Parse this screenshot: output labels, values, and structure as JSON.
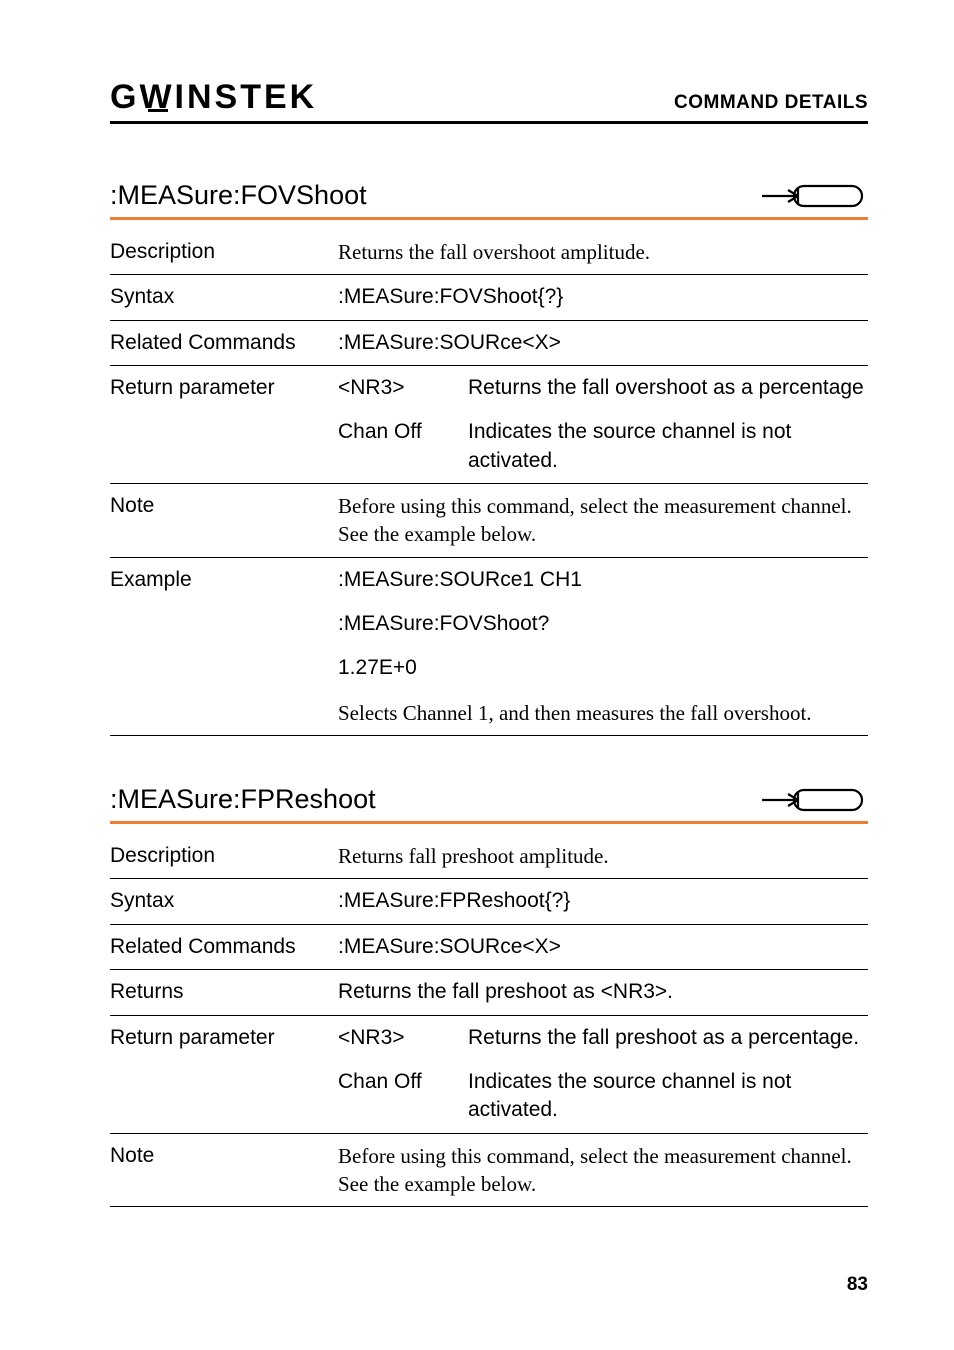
{
  "header": {
    "logo_text": "GWINSTEK",
    "section": "COMMAND DETAILS"
  },
  "page_number": "83",
  "icon": {
    "query": "query-icon"
  },
  "commands": [
    {
      "title": ":MEASure:FOVShoot",
      "rows": [
        {
          "label": "Description",
          "serif": true,
          "text": "Returns the fall overshoot amplitude."
        },
        {
          "label": "Syntax",
          "text": ":MEASure:FOVShoot{?}"
        },
        {
          "label": "Related Commands",
          "text": ":MEASure:SOURce<X>"
        },
        {
          "label": "Return parameter",
          "params": [
            {
              "key": "<NR3>",
              "desc": "Returns the fall overshoot as a percentage"
            },
            {
              "key": "Chan Off",
              "desc": "Indicates the source channel is not activated."
            }
          ]
        },
        {
          "label": "Note",
          "serif": true,
          "text": "Before using this command, select the measurement channel. See the example below."
        },
        {
          "label": "Example",
          "lines": [
            ":MEASure:SOURce1 CH1",
            ":MEASure:FOVShoot?",
            "1.27E+0"
          ],
          "serif_tail": "Selects Channel 1, and then measures the fall overshoot."
        }
      ]
    },
    {
      "title": ":MEASure:FPReshoot",
      "rows": [
        {
          "label": "Description",
          "serif": true,
          "text": "Returns fall preshoot amplitude."
        },
        {
          "label": "Syntax",
          "text": ":MEASure:FPReshoot{?}"
        },
        {
          "label": "Related Commands",
          "text": ":MEASure:SOURce<X>"
        },
        {
          "label": "Returns",
          "text": "Returns the fall preshoot as <NR3>."
        },
        {
          "label": "Return parameter",
          "params": [
            {
              "key": "<NR3>",
              "desc": "Returns the fall preshoot as a percentage."
            },
            {
              "key": "Chan Off",
              "desc": "Indicates the source channel is not activated."
            }
          ]
        },
        {
          "label": "Note",
          "serif": true,
          "text": "Before using this command, select the measurement channel. See the example below."
        }
      ]
    }
  ]
}
